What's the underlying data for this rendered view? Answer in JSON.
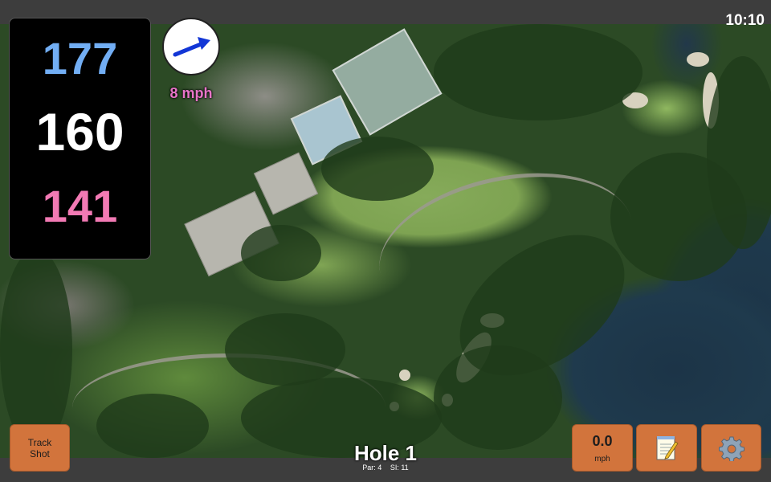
{
  "status": {
    "time": "10:10"
  },
  "distances": {
    "back": "177",
    "middle": "160",
    "front": "141"
  },
  "wind": {
    "speed": "8 mph",
    "direction_icon": "wind-arrow-icon"
  },
  "hole": {
    "title": "Hole 1",
    "par": "Par: 4",
    "si": "SI: 11"
  },
  "buttons": {
    "track_shot": "Track\nShot",
    "speed_value": "0.0",
    "speed_unit": "mph",
    "notes_icon": "notepad-icon",
    "settings_icon": "gear-icon"
  },
  "colors": {
    "back_distance": "#72aef4",
    "middle_distance": "#ffffff",
    "front_distance": "#f27ab4",
    "wind_text": "#e874c8",
    "button": "#d2743c"
  }
}
